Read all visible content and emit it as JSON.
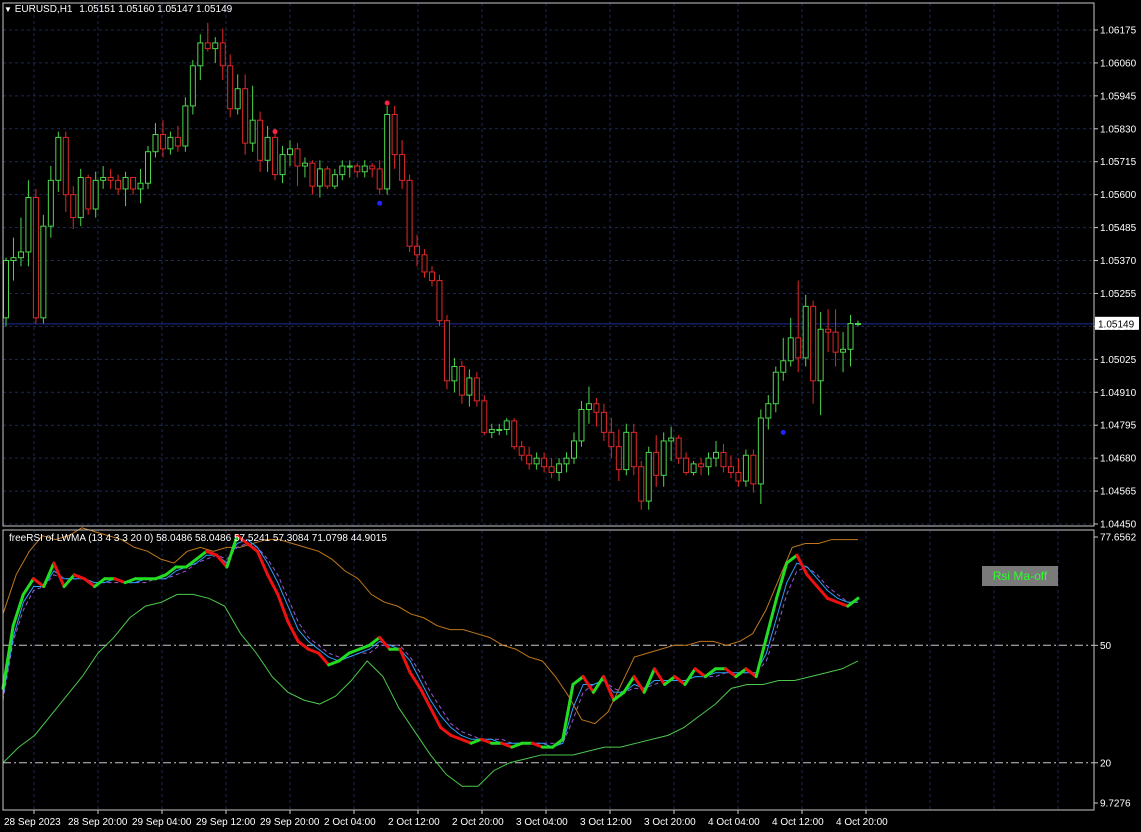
{
  "header": {
    "symbol": "EURUSD,H1",
    "ohlc": "1.05151 1.05160 1.05147 1.05149"
  },
  "indicator": {
    "label": "freeRSI of LWMA (13 4 3 3 20 0) 58.0486 58.0486 57.5241 57.3084 71.0798 44.9015",
    "button_label": "Rsi Ma-off"
  },
  "colors": {
    "background": "#000000",
    "grid": "#1a2a5a",
    "axis": "#c8c8c8",
    "bull": "#4cd64c",
    "bear": "#e02828",
    "current_price_line": "#1e2a9a",
    "rsi_up": "#22dd22",
    "rsi_down": "#ee1111",
    "signal": "#2aa0ff",
    "ma": "#9b59d9",
    "band_upper": "#c0781e",
    "band_lower": "#4cc84c",
    "level_line": "#c8c8c8",
    "dot_red": "#ff2244",
    "dot_blue": "#2222ff"
  },
  "chart_data": [
    {
      "type": "candlestick",
      "title": "EURUSD,H1",
      "ylim": [
        1.0445,
        1.0629
      ],
      "y_ticks": [
        "1.06175",
        "1.06060",
        "1.05945",
        "1.05830",
        "1.05715",
        "1.05600",
        "1.05485",
        "1.05370",
        "1.05255",
        "1.05140",
        "1.05025",
        "1.04910",
        "1.04795",
        "1.04680",
        "1.04565",
        "1.04450"
      ],
      "current_price": "1.05149",
      "x_labels": [
        "28 Sep 2023",
        "28 Sep 20:00",
        "29 Sep 04:00",
        "29 Sep 12:00",
        "29 Sep 20:00",
        "2 Oct 04:00",
        "2 Oct 12:00",
        "2 Oct 20:00",
        "3 Oct 04:00",
        "3 Oct 12:00",
        "3 Oct 20:00",
        "4 Oct 04:00",
        "4 Oct 12:00",
        "4 Oct 20:00"
      ],
      "candles": [
        [
          1.0517,
          1.0538,
          1.0514,
          1.0537
        ],
        [
          1.0537,
          1.0545,
          1.053,
          1.0538
        ],
        [
          1.0538,
          1.0552,
          1.0535,
          1.054
        ],
        [
          1.054,
          1.0565,
          1.0535,
          1.0559
        ],
        [
          1.0559,
          1.0562,
          1.0515,
          1.0517
        ],
        [
          1.0517,
          1.0553,
          1.0515,
          1.0549
        ],
        [
          1.0549,
          1.057,
          1.0545,
          1.0565
        ],
        [
          1.0565,
          1.0582,
          1.0561,
          1.058
        ],
        [
          1.058,
          1.0582,
          1.0554,
          1.056
        ],
        [
          1.056,
          1.0563,
          1.0548,
          1.0552
        ],
        [
          1.0552,
          1.0569,
          1.0549,
          1.0566
        ],
        [
          1.0566,
          1.0567,
          1.0553,
          1.0555
        ],
        [
          1.0555,
          1.0568,
          1.0552,
          1.0565
        ],
        [
          1.0565,
          1.057,
          1.0562,
          1.0566
        ],
        [
          1.0566,
          1.0569,
          1.0562,
          1.0565
        ],
        [
          1.0565,
          1.0567,
          1.056,
          1.0562
        ],
        [
          1.0562,
          1.0568,
          1.0556,
          1.0566
        ],
        [
          1.0566,
          1.0566,
          1.056,
          1.0562
        ],
        [
          1.0562,
          1.0569,
          1.0557,
          1.0564
        ],
        [
          1.0564,
          1.0577,
          1.0562,
          1.0575
        ],
        [
          1.0575,
          1.0585,
          1.0573,
          1.0581
        ],
        [
          1.0581,
          1.0586,
          1.0573,
          1.0576
        ],
        [
          1.0576,
          1.0582,
          1.0574,
          1.058
        ],
        [
          1.058,
          1.0584,
          1.0575,
          1.0577
        ],
        [
          1.0577,
          1.0594,
          1.0575,
          1.0591
        ],
        [
          1.0591,
          1.0607,
          1.0588,
          1.0605
        ],
        [
          1.0605,
          1.0616,
          1.06,
          1.0613
        ],
        [
          1.0613,
          1.062,
          1.061,
          1.0611
        ],
        [
          1.0611,
          1.0615,
          1.0606,
          1.0613
        ],
        [
          1.0613,
          1.0618,
          1.06,
          1.0605
        ],
        [
          1.0605,
          1.0609,
          1.0587,
          1.059
        ],
        [
          1.059,
          1.0602,
          1.0588,
          1.0597
        ],
        [
          1.0597,
          1.0602,
          1.0574,
          1.0578
        ],
        [
          1.0578,
          1.0598,
          1.0575,
          1.0586
        ],
        [
          1.0586,
          1.0589,
          1.0568,
          1.0572
        ],
        [
          1.0572,
          1.0584,
          1.0568,
          1.058
        ],
        [
          1.058,
          1.0582,
          1.0565,
          1.0567
        ],
        [
          1.0567,
          1.0577,
          1.0564,
          1.0574
        ],
        [
          1.0574,
          1.0579,
          1.057,
          1.0576
        ],
        [
          1.0576,
          1.0578,
          1.0563,
          1.057
        ],
        [
          1.057,
          1.0573,
          1.0566,
          1.0571
        ],
        [
          1.0571,
          1.0572,
          1.056,
          1.0563
        ],
        [
          1.0563,
          1.0572,
          1.0559,
          1.0569
        ],
        [
          1.0569,
          1.057,
          1.0562,
          1.0563
        ],
        [
          1.0563,
          1.0569,
          1.0562,
          1.0567
        ],
        [
          1.0567,
          1.0572,
          1.0565,
          1.057
        ],
        [
          1.057,
          1.0572,
          1.0566,
          1.057
        ],
        [
          1.057,
          1.0571,
          1.0566,
          1.0568
        ],
        [
          1.0568,
          1.0572,
          1.0566,
          1.057
        ],
        [
          1.057,
          1.0571,
          1.0566,
          1.0569
        ],
        [
          1.0569,
          1.0572,
          1.056,
          1.0562
        ],
        [
          1.0562,
          1.0591,
          1.056,
          1.0588
        ],
        [
          1.0588,
          1.0591,
          1.0569,
          1.0574
        ],
        [
          1.0574,
          1.0579,
          1.0562,
          1.0565
        ],
        [
          1.0565,
          1.0567,
          1.054,
          1.0542
        ],
        [
          1.0542,
          1.0546,
          1.0535,
          1.0539
        ],
        [
          1.0539,
          1.0541,
          1.0531,
          1.0533
        ],
        [
          1.0533,
          1.0535,
          1.0528,
          1.053
        ],
        [
          1.053,
          1.0532,
          1.0514,
          1.0516
        ],
        [
          1.0516,
          1.0518,
          1.0492,
          1.0495
        ],
        [
          1.0495,
          1.0503,
          1.0491,
          1.05
        ],
        [
          1.05,
          1.0502,
          1.0487,
          1.049
        ],
        [
          1.049,
          1.0499,
          1.0486,
          1.0496
        ],
        [
          1.0496,
          1.0498,
          1.0486,
          1.0488
        ],
        [
          1.0488,
          1.049,
          1.0476,
          1.0477
        ],
        [
          1.0477,
          1.048,
          1.0475,
          1.0478
        ],
        [
          1.0478,
          1.048,
          1.0476,
          1.0478
        ],
        [
          1.0478,
          1.0482,
          1.0476,
          1.0481
        ],
        [
          1.0481,
          1.0482,
          1.0471,
          1.0472
        ],
        [
          1.0472,
          1.0474,
          1.0467,
          1.0469
        ],
        [
          1.0469,
          1.0472,
          1.0464,
          1.0466
        ],
        [
          1.0466,
          1.047,
          1.0464,
          1.0468
        ],
        [
          1.0468,
          1.047,
          1.0463,
          1.0465
        ],
        [
          1.0465,
          1.0468,
          1.0461,
          1.0463
        ],
        [
          1.0463,
          1.0468,
          1.046,
          1.0466
        ],
        [
          1.0466,
          1.047,
          1.0463,
          1.0468
        ],
        [
          1.0468,
          1.0477,
          1.0466,
          1.0474
        ],
        [
          1.0474,
          1.0488,
          1.0472,
          1.0485
        ],
        [
          1.0485,
          1.0493,
          1.048,
          1.0487
        ],
        [
          1.0487,
          1.0489,
          1.0479,
          1.0484
        ],
        [
          1.0484,
          1.0487,
          1.0474,
          1.0477
        ],
        [
          1.0477,
          1.0482,
          1.0468,
          1.0472
        ],
        [
          1.0472,
          1.0478,
          1.046,
          1.0464
        ],
        [
          1.0464,
          1.048,
          1.0462,
          1.0477
        ],
        [
          1.0477,
          1.048,
          1.0462,
          1.0465
        ],
        [
          1.0465,
          1.0467,
          1.045,
          1.0453
        ],
        [
          1.0453,
          1.0472,
          1.045,
          1.047
        ],
        [
          1.047,
          1.0476,
          1.0458,
          1.0462
        ],
        [
          1.0462,
          1.0477,
          1.0458,
          1.0474
        ],
        [
          1.0474,
          1.0479,
          1.0467,
          1.0475
        ],
        [
          1.0475,
          1.0476,
          1.0466,
          1.0468
        ],
        [
          1.0468,
          1.047,
          1.0462,
          1.0463
        ],
        [
          1.0463,
          1.0467,
          1.0462,
          1.0466
        ],
        [
          1.0466,
          1.0468,
          1.0462,
          1.0465
        ],
        [
          1.0465,
          1.047,
          1.0462,
          1.0468
        ],
        [
          1.0468,
          1.0474,
          1.0465,
          1.047
        ],
        [
          1.047,
          1.0473,
          1.0463,
          1.0465
        ],
        [
          1.0465,
          1.0469,
          1.0461,
          1.0463
        ],
        [
          1.0463,
          1.0468,
          1.0458,
          1.046
        ],
        [
          1.046,
          1.0471,
          1.0458,
          1.0469
        ],
        [
          1.0469,
          1.0471,
          1.0456,
          1.0459
        ],
        [
          1.0459,
          1.0485,
          1.0452,
          1.0482
        ],
        [
          1.0482,
          1.049,
          1.0478,
          1.0487
        ],
        [
          1.0487,
          1.05,
          1.0484,
          1.0498
        ],
        [
          1.0498,
          1.051,
          1.0495,
          1.0502
        ],
        [
          1.0502,
          1.0517,
          1.05,
          1.051
        ],
        [
          1.051,
          1.053,
          1.0498,
          1.0503
        ],
        [
          1.0503,
          1.0525,
          1.05,
          1.0521
        ],
        [
          1.0521,
          1.0523,
          1.0487,
          1.0495
        ],
        [
          1.0495,
          1.0519,
          1.0483,
          1.0513
        ],
        [
          1.0513,
          1.052,
          1.0505,
          1.0512
        ],
        [
          1.0512,
          1.052,
          1.05,
          1.0505
        ],
        [
          1.0505,
          1.0512,
          1.0498,
          1.0506
        ],
        [
          1.0506,
          1.0518,
          1.05,
          1.0515
        ],
        [
          1.0515,
          1.0516,
          1.0514,
          1.0515
        ]
      ],
      "signals": [
        {
          "candle": 36,
          "price": 1.0582,
          "color": "red"
        },
        {
          "candle": 51,
          "price": 1.0592,
          "color": "red"
        },
        {
          "candle": 50,
          "price": 1.0557,
          "color": "blue"
        },
        {
          "candle": 104,
          "price": 1.0477,
          "color": "blue"
        }
      ]
    },
    {
      "type": "line",
      "title": "freeRSI of LWMA (13 4 3 3 20 0)",
      "ylim": [
        9.7276,
        77.6562
      ],
      "y_ticks": [
        "77.6562",
        "50",
        "20",
        "9.7276"
      ],
      "levels": [
        50,
        20
      ],
      "series": [
        {
          "role": "rsi",
          "values": [
            39,
            55,
            63,
            67,
            65,
            71,
            65,
            68,
            67,
            65,
            67,
            67,
            66,
            67,
            67,
            67,
            68,
            70,
            70,
            72,
            74,
            73,
            70,
            78,
            76,
            74,
            68,
            63,
            56,
            51,
            49,
            48,
            45,
            46,
            48,
            49,
            50,
            52,
            49,
            49,
            43,
            39,
            34,
            29,
            27,
            26,
            25,
            26,
            25,
            25,
            24,
            25,
            25,
            24,
            24,
            26,
            40,
            42,
            38,
            42,
            36,
            38,
            42,
            38,
            44,
            40,
            42,
            40,
            44,
            42,
            44,
            44,
            42,
            44,
            42,
            52,
            62,
            71,
            73,
            68,
            65,
            62,
            61,
            60,
            62
          ]
        },
        {
          "role": "signal",
          "values": [
            37,
            52,
            61,
            65,
            65,
            69,
            67,
            67,
            67,
            66,
            66,
            67,
            66,
            66,
            67,
            67,
            67,
            69,
            70,
            71,
            73,
            73,
            71,
            76,
            77,
            75,
            71,
            66,
            60,
            54,
            51,
            49,
            47,
            46,
            47,
            48,
            49,
            51,
            50,
            49,
            46,
            41,
            36,
            32,
            29,
            27,
            26,
            26,
            26,
            25,
            25,
            25,
            25,
            25,
            24,
            25,
            34,
            40,
            40,
            41,
            38,
            38,
            40,
            39,
            41,
            41,
            41,
            41,
            42,
            42,
            43,
            43,
            43,
            43,
            43,
            48,
            57,
            66,
            71,
            70,
            67,
            64,
            62,
            61,
            61
          ]
        },
        {
          "role": "ma",
          "values": [
            36,
            51,
            59,
            64,
            65,
            68,
            67,
            67,
            67,
            66,
            66,
            66,
            66,
            66,
            66,
            67,
            67,
            68,
            69,
            71,
            72,
            73,
            72,
            75,
            76,
            75,
            72,
            68,
            62,
            56,
            52,
            50,
            48,
            47,
            47,
            48,
            48,
            50,
            50,
            50,
            47,
            43,
            38,
            34,
            30,
            28,
            27,
            26,
            26,
            26,
            25,
            25,
            25,
            25,
            25,
            25,
            31,
            38,
            40,
            41,
            39,
            38,
            39,
            39,
            40,
            41,
            41,
            41,
            42,
            42,
            42,
            43,
            43,
            43,
            43,
            46,
            54,
            63,
            69,
            70,
            68,
            65,
            63,
            61,
            61
          ]
        },
        {
          "role": "band_upper",
          "values": [
            58,
            68,
            74,
            78,
            77,
            78,
            80,
            79,
            78,
            77,
            75,
            74,
            72,
            71,
            74,
            75,
            74,
            75,
            75,
            76,
            77,
            77,
            76,
            75,
            74,
            72,
            69,
            67,
            63,
            61,
            60,
            58,
            57,
            55,
            54,
            54,
            53,
            52,
            50,
            49,
            47,
            46,
            42,
            37,
            31,
            30,
            33,
            40,
            47,
            48,
            49,
            50,
            50,
            51,
            51,
            50,
            51,
            53,
            59,
            67,
            75,
            76,
            76,
            77,
            77,
            77
          ]
        },
        {
          "role": "band_lower",
          "values": [
            20,
            24,
            27,
            32,
            37,
            42,
            48,
            52,
            57,
            60,
            61,
            63,
            63,
            62,
            60,
            53,
            48,
            42,
            38,
            36,
            35,
            37,
            41,
            46,
            42,
            34,
            28,
            22,
            17,
            14,
            14,
            18,
            20,
            21,
            22,
            22,
            22,
            23,
            24,
            24,
            25,
            26,
            27,
            29,
            32,
            35,
            39,
            40,
            40,
            41,
            41,
            42,
            43,
            44,
            46
          ]
        }
      ]
    }
  ]
}
